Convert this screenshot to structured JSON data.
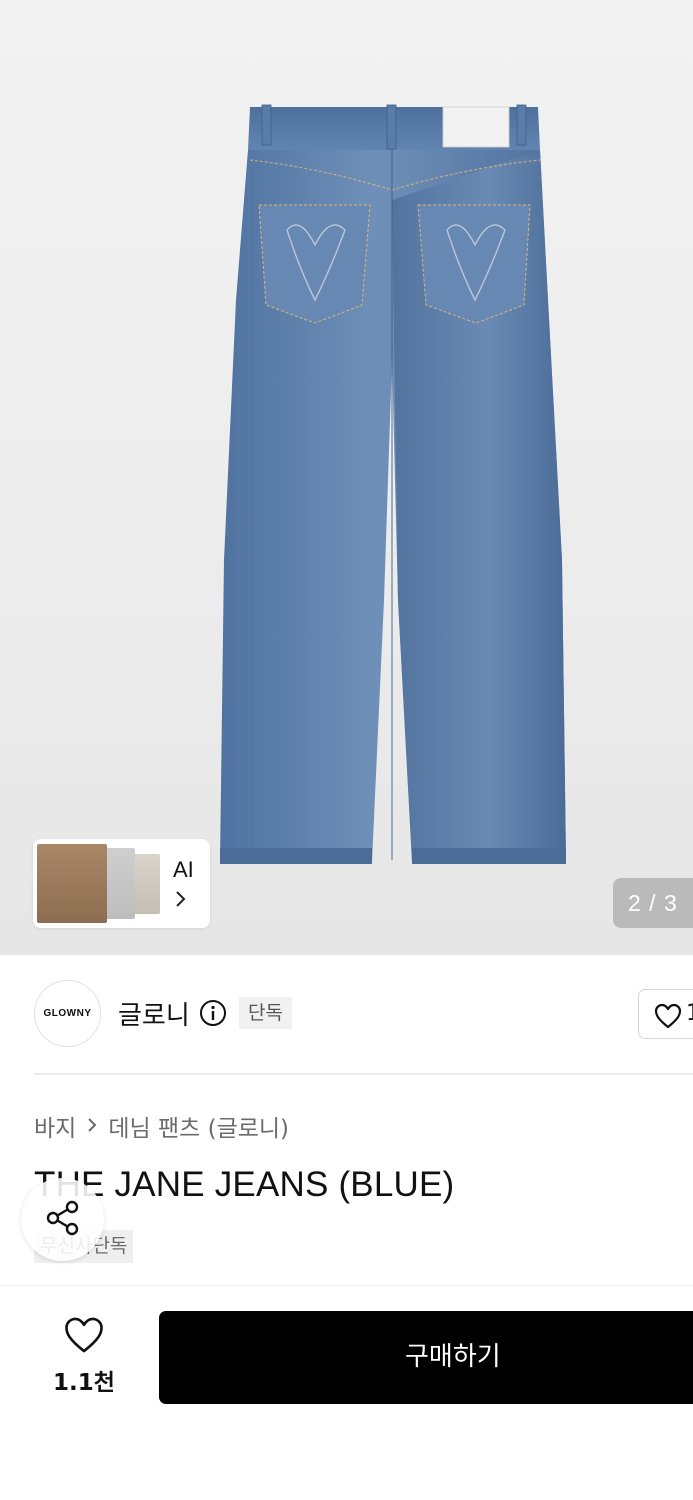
{
  "product_image": {
    "counter": "2 / 3"
  },
  "ai_card": {
    "label": "AI"
  },
  "brand": {
    "logo_text": "GLOWNY",
    "name": "글로니",
    "badge": "단독",
    "follow_count": "1"
  },
  "breadcrumb": {
    "level1": "바지",
    "level2": "데님 팬츠 (글로니)"
  },
  "product": {
    "title": "THE JANE JEANS (BLUE)",
    "exclusive_badge": "무신사단독"
  },
  "bottom_bar": {
    "wish_count": "1.1천",
    "buy_label": "구매하기"
  },
  "icons": {
    "info": "info-icon",
    "heart": "heart-icon",
    "share": "share-icon",
    "chevron": "chevron-right-icon"
  },
  "colors": {
    "denim": "#5577a3",
    "denim_dark": "#3f5f88",
    "buy_button": "#000000",
    "badge_bg": "#f1f1f1"
  }
}
